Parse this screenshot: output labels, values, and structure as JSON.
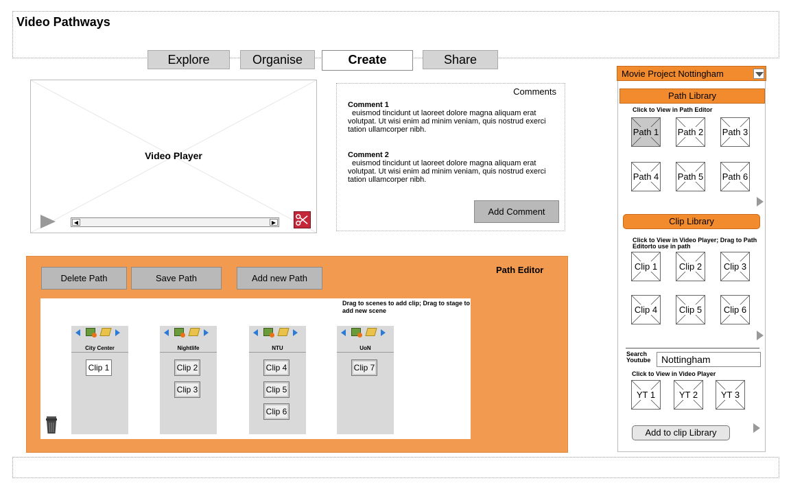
{
  "app": {
    "title": "Video Pathways"
  },
  "tabs": [
    {
      "label": "Explore"
    },
    {
      "label": "Organise"
    },
    {
      "label": "Create"
    },
    {
      "label": "Share"
    }
  ],
  "video_player": {
    "label": "Video Player"
  },
  "comments": {
    "heading": "Comments",
    "items": [
      {
        "title": "Comment 1",
        "body": "euismod tincidunt ut laoreet dolore magna aliquam erat volutpat. Ut wisi enim ad minim veniam, quis nostrud exerci tation ullamcorper nibh."
      },
      {
        "title": "Comment 2",
        "body": "euismod tincidunt ut laoreet dolore magna aliquam erat volutpat. Ut wisi enim ad minim veniam, quis nostrud exerci tation ullamcorper nibh."
      }
    ],
    "add_label": "Add Comment"
  },
  "path_editor": {
    "title": "Path Editor",
    "buttons": {
      "delete": "Delete Path",
      "save": "Save Path",
      "add": "Add new Path"
    },
    "hint": "Drag to scenes to add clip; Drag to stage to add new scene",
    "scenes": [
      {
        "name": "City Center",
        "clips": [
          "Clip 1"
        ]
      },
      {
        "name": "Nightlife",
        "clips": [
          "Clip 2",
          "Clip 3"
        ]
      },
      {
        "name": "NTU",
        "clips": [
          "Clip 4",
          "Clip 5",
          "Clip 6"
        ]
      },
      {
        "name": "UoN",
        "clips": [
          "Clip 7"
        ]
      }
    ]
  },
  "sidebar": {
    "project_select": "Movie Project Nottingham",
    "path_library": {
      "title": "Path Library",
      "hint": "Click to View in Path Editor",
      "items": [
        "Path 1",
        "Path 2",
        "Path 3",
        "Path 4",
        "Path 5",
        "Path 6"
      ]
    },
    "clip_library": {
      "title": "Clip Library",
      "hint": "Click to View in Video Player; Drag to Path Editorto use in path",
      "items": [
        "Clip 1",
        "Clip 2",
        "Clip 3",
        "Clip 4",
        "Clip 5",
        "Clip 6"
      ]
    },
    "youtube": {
      "search_label_1": "Search",
      "search_label_2": "Youtube",
      "search_value": "Nottingham",
      "hint": "Click to View in Video Player",
      "items": [
        "YT 1",
        "YT 2",
        "YT 3"
      ],
      "add_label": "Add to clip Library"
    }
  }
}
